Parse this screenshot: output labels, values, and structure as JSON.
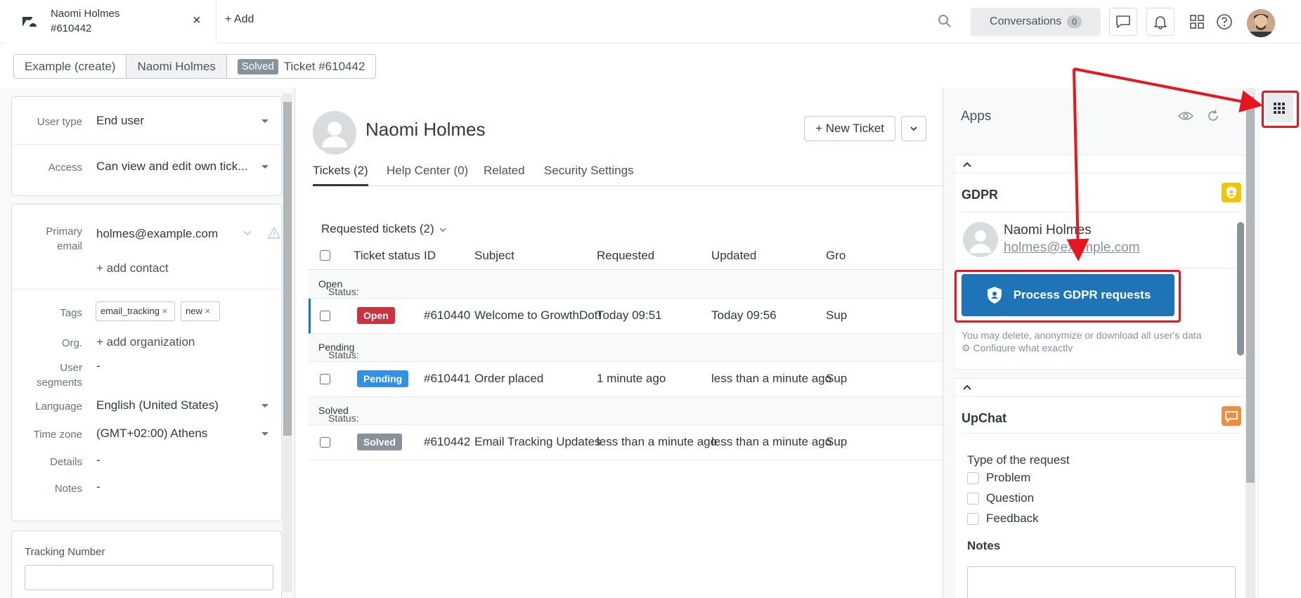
{
  "topbar": {
    "tab": {
      "name": "Naomi Holmes",
      "number": "#610442",
      "close": "×"
    },
    "add_label": "+ Add",
    "conversations": {
      "label": "Conversations",
      "count": "0"
    }
  },
  "breadcrumb": {
    "items": [
      "Example (create)",
      "Naomi Holmes"
    ],
    "status_badge": "Solved",
    "ticket": "Ticket #610442"
  },
  "user": {
    "user_type_label": "User type",
    "user_type": "End user",
    "access_label": "Access",
    "access": "Can view and edit own tick...",
    "primary_email_label_1": "Primary",
    "primary_email_label_2": "email",
    "primary_email": "holmes@example.com",
    "add_contact": "+ add contact",
    "tags_label": "Tags",
    "tags": [
      "email_tracking",
      "new"
    ],
    "org_label": "Org.",
    "add_org": "+ add organization",
    "segments_label_1": "User",
    "segments_label_2": "segments",
    "segments": "-",
    "language_label": "Language",
    "language": "English (United States)",
    "timezone_label": "Time zone",
    "timezone": "(GMT+02:00) Athens",
    "details_label": "Details",
    "details": "-",
    "notes_label": "Notes",
    "notes": "-",
    "tracking_label": "Tracking Number",
    "tracking_value": ""
  },
  "profile": {
    "name": "Naomi Holmes",
    "new_ticket": "+ New Ticket",
    "tabs": [
      "Tickets (2)",
      "Help Center (0)",
      "Related",
      "Security Settings"
    ]
  },
  "tickets": {
    "title": "Requested tickets (2)",
    "headers": [
      "Ticket status",
      "ID",
      "Subject",
      "Requested",
      "Updated",
      "Gro"
    ],
    "groups": [
      {
        "prefix": "Status:",
        "name": "Open",
        "row": {
          "status": "Open",
          "id": "#610440",
          "subject": "Welcome to GrowthDot!",
          "requested": "Today 09:51",
          "updated": "Today 09:56",
          "group": "Sup"
        }
      },
      {
        "prefix": "Status:",
        "name": "Pending",
        "row": {
          "status": "Pending",
          "id": "#610441",
          "subject": "Order placed",
          "requested": "1 minute ago",
          "updated": "less than a minute ago",
          "group": "Sup"
        }
      },
      {
        "prefix": "Status:",
        "name": "Solved",
        "row": {
          "status": "Solved",
          "id": "#610442",
          "subject": "Email Tracking Updates",
          "requested": "less than a minute ago",
          "updated": "less than a minute ago",
          "group": "Sup"
        }
      }
    ]
  },
  "apps": {
    "title": "Apps",
    "gdpr": {
      "title": "GDPR",
      "user_name": "Naomi Holmes",
      "user_email": "holmes@example.com",
      "button": "Process GDPR requests",
      "hint": "You may delete, anonymize or download all user's data",
      "configure": "Configure what exactly"
    },
    "upchat": {
      "title": "UpChat",
      "type_label": "Type of the request",
      "options": [
        "Problem",
        "Question",
        "Feedback"
      ],
      "notes_label": "Notes"
    }
  },
  "colors": {
    "open": "#cc3340",
    "pending": "#3091ec",
    "solved": "#87929d",
    "primary": "#1f73b7",
    "annotation": "#e8141e"
  }
}
